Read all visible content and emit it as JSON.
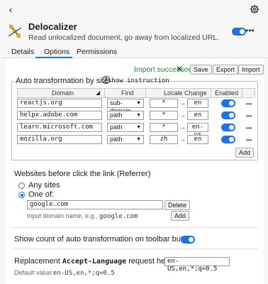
{
  "extension": {
    "name": "Delocalizer",
    "description": "Read unlocalized document, go away from localized URL."
  },
  "tabs": [
    {
      "label": "Details"
    },
    {
      "label": "Options"
    },
    {
      "label": "Permissions"
    }
  ],
  "status": {
    "message": "Import successed",
    "save": "Save",
    "export": "Export",
    "import": "Import"
  },
  "auto": {
    "legend": "Auto transformation by site",
    "show_instruction": "show instruction",
    "headers": {
      "domain": "Domain",
      "find": "Find",
      "locale": "Locale Change",
      "enabled": "Enabled"
    },
    "rows": [
      {
        "domain": "reactjs.org",
        "find": "sub-domain",
        "from": "*",
        "to": "en",
        "enabled": true
      },
      {
        "domain": "helpx.adobe.com",
        "find": "path",
        "from": "*",
        "to": "en",
        "enabled": true
      },
      {
        "domain": "learn.microsoft.com",
        "find": "path",
        "from": "*",
        "to": "en-us",
        "enabled": true
      },
      {
        "domain": "mozilla.org",
        "find": "path",
        "from": "zh",
        "to": "en",
        "enabled": true
      }
    ],
    "add": "Add"
  },
  "referrer": {
    "title": "Websites before click the link (Referrer)",
    "any": "Any sites",
    "one_of": "One of:",
    "domain_value": "google.com",
    "delete": "Delete",
    "hint_prefix": "Input domain name, e.g.,",
    "hint_example": "google.com",
    "add": "Add"
  },
  "toolbar_count": {
    "label": "Show count of auto transformation on toolbar button",
    "enabled": true
  },
  "accept_language": {
    "label_prefix": "Replacement",
    "label_code": "Accept-Language",
    "label_suffix": "request header:",
    "value": "en-US,en,*;q=0.5",
    "default_prefix": "Default value:",
    "default_value": "en-US,en,*;q=0.5"
  },
  "colors": {
    "accent": "#1a73e8",
    "success": "#1b8a3a"
  }
}
